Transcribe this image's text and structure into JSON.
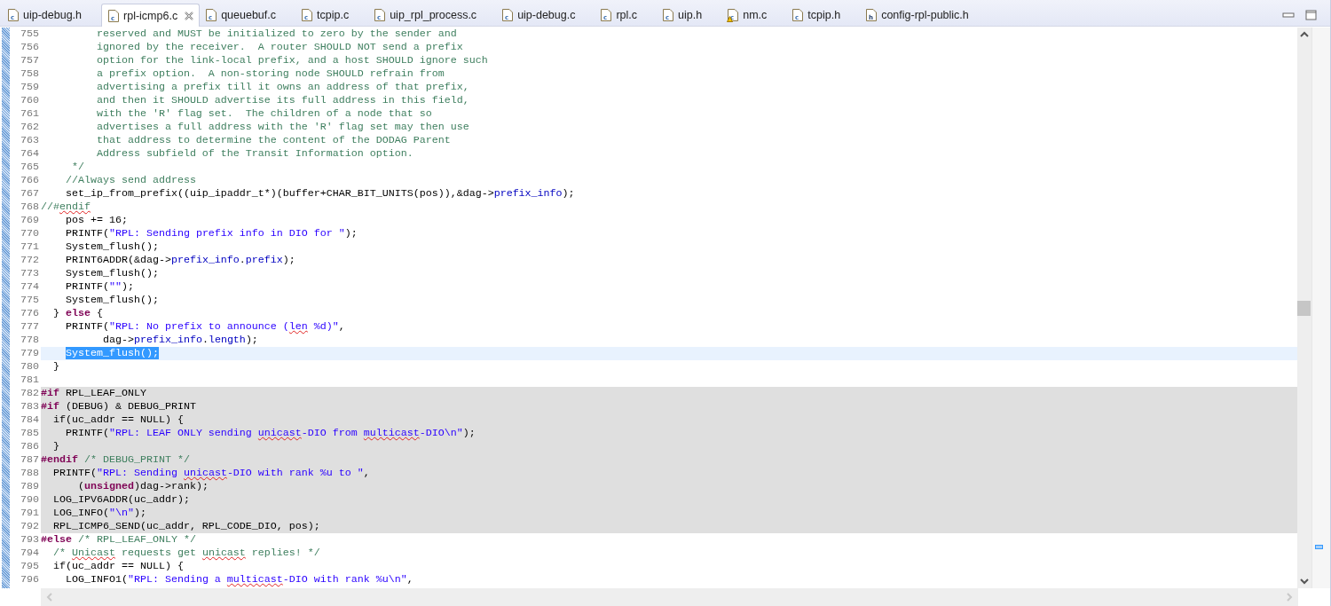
{
  "tabs": [
    {
      "label": "uip-debug.h",
      "file_kind": "c",
      "warning": false,
      "selected": false
    },
    {
      "label": "rpl-icmp6.c",
      "file_kind": "c",
      "warning": false,
      "selected": true
    },
    {
      "label": "queuebuf.c",
      "file_kind": "c",
      "warning": false,
      "selected": false
    },
    {
      "label": "tcpip.c",
      "file_kind": "c",
      "warning": false,
      "selected": false
    },
    {
      "label": "uip_rpl_process.c",
      "file_kind": "c",
      "warning": false,
      "selected": false
    },
    {
      "label": "uip-debug.c",
      "file_kind": "c",
      "warning": false,
      "selected": false
    },
    {
      "label": "rpl.c",
      "file_kind": "c",
      "warning": false,
      "selected": false
    },
    {
      "label": "uip.h",
      "file_kind": "c",
      "warning": false,
      "selected": false
    },
    {
      "label": "nm.c",
      "file_kind": "c",
      "warning": true,
      "selected": false
    },
    {
      "label": "tcpip.h",
      "file_kind": "c",
      "warning": false,
      "selected": false
    },
    {
      "label": "config-rpl-public.h",
      "file_kind": "h",
      "warning": false,
      "selected": false
    }
  ],
  "lines": [
    {
      "number": "755",
      "current": false,
      "inactive": false,
      "segments": [
        {
          "kind": "comment",
          "text": "         reserved and MUST be initialized to zero by the sender and"
        }
      ]
    },
    {
      "number": "756",
      "current": false,
      "inactive": false,
      "segments": [
        {
          "kind": "comment",
          "text": "         ignored by the receiver.  A router SHOULD NOT send a prefix"
        }
      ]
    },
    {
      "number": "757",
      "current": false,
      "inactive": false,
      "segments": [
        {
          "kind": "comment",
          "text": "         option for the link-local prefix, and a host SHOULD ignore such"
        }
      ]
    },
    {
      "number": "758",
      "current": false,
      "inactive": false,
      "segments": [
        {
          "kind": "comment",
          "text": "         a prefix option.  A non-storing node SHOULD refrain from"
        }
      ]
    },
    {
      "number": "759",
      "current": false,
      "inactive": false,
      "segments": [
        {
          "kind": "comment",
          "text": "         advertising a prefix till it owns an address of that prefix,"
        }
      ]
    },
    {
      "number": "760",
      "current": false,
      "inactive": false,
      "segments": [
        {
          "kind": "comment",
          "text": "         and then it SHOULD advertise its full address in this field,"
        }
      ]
    },
    {
      "number": "761",
      "current": false,
      "inactive": false,
      "segments": [
        {
          "kind": "comment",
          "text": "         with the 'R' flag set.  The children of a node that so"
        }
      ]
    },
    {
      "number": "762",
      "current": false,
      "inactive": false,
      "segments": [
        {
          "kind": "comment",
          "text": "         advertises a full address with the 'R' flag set may then use"
        }
      ]
    },
    {
      "number": "763",
      "current": false,
      "inactive": false,
      "segments": [
        {
          "kind": "comment",
          "text": "         that address to determine the content of the DODAG Parent"
        }
      ]
    },
    {
      "number": "764",
      "current": false,
      "inactive": false,
      "segments": [
        {
          "kind": "comment",
          "text": "         Address subfield of the Transit Information option."
        }
      ]
    },
    {
      "number": "765",
      "current": false,
      "inactive": false,
      "segments": [
        {
          "kind": "comment",
          "text": "     */"
        }
      ]
    },
    {
      "number": "766",
      "current": false,
      "inactive": false,
      "segments": [
        {
          "kind": "comment",
          "text": "    //Always send address"
        }
      ]
    },
    {
      "number": "767",
      "current": false,
      "inactive": false,
      "segments": [
        {
          "kind": "plain",
          "text": "    set_ip_from_prefix((uip_ipaddr_t*)(buffer+CHAR_BIT_UNITS(pos)),&dag->"
        },
        {
          "kind": "field",
          "text": "prefix_info"
        },
        {
          "kind": "plain",
          "text": ");"
        }
      ]
    },
    {
      "number": "768",
      "current": false,
      "inactive": false,
      "segments": [
        {
          "kind": "comment",
          "text": "//#"
        },
        {
          "kind": "comment",
          "text": "endif",
          "misspelled": true
        }
      ]
    },
    {
      "number": "769",
      "current": false,
      "inactive": false,
      "segments": [
        {
          "kind": "plain",
          "text": "    pos += 16;"
        }
      ]
    },
    {
      "number": "770",
      "current": false,
      "inactive": false,
      "segments": [
        {
          "kind": "plain",
          "text": "    PRINTF("
        },
        {
          "kind": "string",
          "text": "\"RPL: Sending prefix info in DIO for \""
        },
        {
          "kind": "plain",
          "text": ");"
        }
      ]
    },
    {
      "number": "771",
      "current": false,
      "inactive": false,
      "segments": [
        {
          "kind": "plain",
          "text": "    System_flush();"
        }
      ]
    },
    {
      "number": "772",
      "current": false,
      "inactive": false,
      "segments": [
        {
          "kind": "plain",
          "text": "    PRINT6ADDR(&dag->"
        },
        {
          "kind": "field",
          "text": "prefix_info"
        },
        {
          "kind": "plain",
          "text": "."
        },
        {
          "kind": "field",
          "text": "prefix"
        },
        {
          "kind": "plain",
          "text": ");"
        }
      ]
    },
    {
      "number": "773",
      "current": false,
      "inactive": false,
      "segments": [
        {
          "kind": "plain",
          "text": "    System_flush();"
        }
      ]
    },
    {
      "number": "774",
      "current": false,
      "inactive": false,
      "segments": [
        {
          "kind": "plain",
          "text": "    PRINTF("
        },
        {
          "kind": "string",
          "text": "\"\""
        },
        {
          "kind": "plain",
          "text": ");"
        }
      ]
    },
    {
      "number": "775",
      "current": false,
      "inactive": false,
      "segments": [
        {
          "kind": "plain",
          "text": "    System_flush();"
        }
      ]
    },
    {
      "number": "776",
      "current": false,
      "inactive": false,
      "segments": [
        {
          "kind": "plain",
          "text": "  } "
        },
        {
          "kind": "keyword",
          "text": "else"
        },
        {
          "kind": "plain",
          "text": " {"
        }
      ]
    },
    {
      "number": "777",
      "current": false,
      "inactive": false,
      "segments": [
        {
          "kind": "plain",
          "text": "    PRINTF("
        },
        {
          "kind": "string",
          "text": "\"RPL: No prefix to announce ("
        },
        {
          "kind": "string",
          "text": "len",
          "misspelled": true
        },
        {
          "kind": "string",
          "text": " %d)\""
        },
        {
          "kind": "plain",
          "text": ","
        }
      ]
    },
    {
      "number": "778",
      "current": false,
      "inactive": false,
      "segments": [
        {
          "kind": "plain",
          "text": "          dag->"
        },
        {
          "kind": "field",
          "text": "prefix_info"
        },
        {
          "kind": "plain",
          "text": "."
        },
        {
          "kind": "field",
          "text": "length"
        },
        {
          "kind": "plain",
          "text": ");"
        }
      ]
    },
    {
      "number": "779",
      "current": true,
      "inactive": false,
      "segments": [
        {
          "kind": "selection",
          "text": "System_flush();"
        }
      ]
    },
    {
      "number": "780",
      "current": false,
      "inactive": false,
      "segments": [
        {
          "kind": "plain",
          "text": "  }"
        }
      ]
    },
    {
      "number": "781",
      "current": false,
      "inactive": false
    },
    {
      "number": "782",
      "current": false,
      "inactive": true,
      "segments": [
        {
          "kind": "keyword",
          "text": "#if"
        },
        {
          "kind": "plain",
          "text": " RPL_LEAF_ONLY"
        }
      ]
    },
    {
      "number": "783",
      "current": false,
      "inactive": true,
      "segments": [
        {
          "kind": "keyword",
          "text": "#if"
        },
        {
          "kind": "plain",
          "text": " (DEBUG) & DEBUG_PRINT"
        }
      ]
    },
    {
      "number": "784",
      "current": false,
      "inactive": true,
      "segments": [
        {
          "kind": "plain",
          "text": "  if(uc_addr == NULL) {"
        }
      ]
    },
    {
      "number": "785",
      "current": false,
      "inactive": true,
      "segments": [
        {
          "kind": "plain",
          "text": "    PRINTF("
        },
        {
          "kind": "string",
          "text": "\"RPL: LEAF ONLY sending "
        },
        {
          "kind": "string",
          "text": "unicast",
          "misspelled": true
        },
        {
          "kind": "string",
          "text": "-DIO from "
        },
        {
          "kind": "string",
          "text": "multicast",
          "misspelled": true
        },
        {
          "kind": "string",
          "text": "-DIO\\n\""
        },
        {
          "kind": "plain",
          "text": ");"
        }
      ]
    },
    {
      "number": "786",
      "current": false,
      "inactive": true,
      "segments": [
        {
          "kind": "plain",
          "text": "  }"
        }
      ]
    },
    {
      "number": "787",
      "current": false,
      "inactive": true,
      "segments": [
        {
          "kind": "keyword",
          "text": "#endif"
        },
        {
          "kind": "comment",
          "text": " /* DEBUG_PRINT */"
        }
      ]
    },
    {
      "number": "788",
      "current": false,
      "inactive": true,
      "segments": [
        {
          "kind": "plain",
          "text": "  PRINTF("
        },
        {
          "kind": "string",
          "text": "\"RPL: Sending "
        },
        {
          "kind": "string",
          "text": "unicast",
          "misspelled": true
        },
        {
          "kind": "string",
          "text": "-DIO with rank %u to \""
        },
        {
          "kind": "plain",
          "text": ","
        }
      ]
    },
    {
      "number": "789",
      "current": false,
      "inactive": true,
      "segments": [
        {
          "kind": "plain",
          "text": "      ("
        },
        {
          "kind": "keyword",
          "text": "unsigned"
        },
        {
          "kind": "plain",
          "text": ")dag->rank);"
        }
      ]
    },
    {
      "number": "790",
      "current": false,
      "inactive": true,
      "segments": [
        {
          "kind": "plain",
          "text": "  LOG_IPV6ADDR(uc_addr);"
        }
      ]
    },
    {
      "number": "791",
      "current": false,
      "inactive": true,
      "segments": [
        {
          "kind": "plain",
          "text": "  LOG_INFO("
        },
        {
          "kind": "string",
          "text": "\"\\n\""
        },
        {
          "kind": "plain",
          "text": ");"
        }
      ]
    },
    {
      "number": "792",
      "current": false,
      "inactive": true,
      "segments": [
        {
          "kind": "plain",
          "text": "  RPL_ICMP6_SEND(uc_addr, RPL_CODE_DIO, pos);"
        }
      ]
    },
    {
      "number": "793",
      "current": false,
      "inactive": false,
      "segments": [
        {
          "kind": "keyword",
          "text": "#else"
        },
        {
          "kind": "comment",
          "text": " /* RPL_LEAF_ONLY */"
        }
      ]
    },
    {
      "number": "794",
      "current": false,
      "inactive": false,
      "segments": [
        {
          "kind": "comment",
          "text": "  /* "
        },
        {
          "kind": "comment",
          "text": "Unicast",
          "misspelled": true
        },
        {
          "kind": "comment",
          "text": " requests get "
        },
        {
          "kind": "comment",
          "text": "unicast",
          "misspelled": true
        },
        {
          "kind": "comment",
          "text": " replies! */"
        }
      ]
    },
    {
      "number": "795",
      "current": false,
      "inactive": false,
      "segments": [
        {
          "kind": "plain",
          "text": "  if(uc_addr == NULL) {"
        }
      ]
    },
    {
      "number": "796",
      "current": false,
      "inactive": false,
      "segments": [
        {
          "kind": "plain",
          "text": "    LOG_INFO1("
        },
        {
          "kind": "string",
          "text": "\"RPL: Sending a "
        },
        {
          "kind": "string",
          "text": "multicast",
          "misspelled": true
        },
        {
          "kind": "string",
          "text": "-DIO with rank %u\\n\""
        },
        {
          "kind": "plain",
          "text": ","
        }
      ]
    }
  ]
}
